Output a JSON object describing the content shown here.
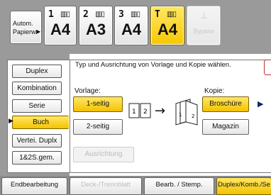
{
  "trays": {
    "auto_select": {
      "line1": "Autom.",
      "line2": "Papierw."
    },
    "items": [
      {
        "number": "1",
        "size": "A4"
      },
      {
        "number": "2",
        "size": "A3"
      },
      {
        "number": "3",
        "size": "A4"
      },
      {
        "number": "T",
        "size": "A4"
      }
    ],
    "bypass_label": "Bypass"
  },
  "menu": {
    "items": [
      {
        "label": "Duplex"
      },
      {
        "label": "Kombination"
      },
      {
        "label": "Serie"
      },
      {
        "label": "Buch"
      },
      {
        "label": "Vertei. Duplx"
      },
      {
        "label": "1&2S.gem."
      }
    ]
  },
  "panel": {
    "instruction": "Typ und Ausrichtung von Vorlage und Kopie wählen.",
    "original_label": "Vorlage:",
    "original_options": [
      "1-seitig",
      "2-seitig"
    ],
    "copy_label": "Kopie:",
    "copy_options": [
      "Broschüre",
      "Magazin"
    ],
    "orientation_label": "Ausrichtung"
  },
  "tabs": [
    {
      "label": "Endbearbeitung"
    },
    {
      "label": "Deck-/Trennblatt"
    },
    {
      "label": "Bearb. / Stemp."
    },
    {
      "label": "Duplex/Komb./Se"
    }
  ],
  "colors": {
    "selected": "#f7c800",
    "frame": "#9a9a9a"
  }
}
